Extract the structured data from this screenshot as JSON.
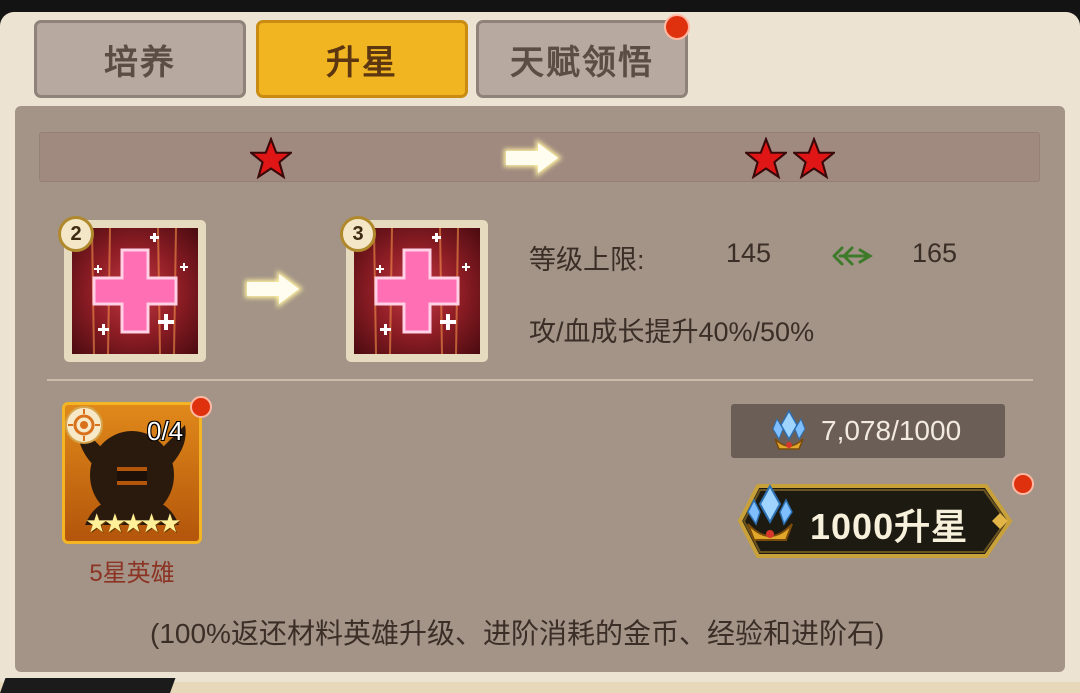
{
  "tabs": [
    {
      "label": "培养",
      "active": false
    },
    {
      "label": "升星",
      "active": true
    },
    {
      "label": "天赋领悟",
      "active": false,
      "notification": true
    }
  ],
  "star_transition": {
    "from_stars": 1,
    "to_stars": 2
  },
  "skill": {
    "from_level": "2",
    "to_level": "3",
    "level_cap_label": "等级上限:",
    "level_cap_from": "145",
    "level_cap_to": "165",
    "growth_text": "攻/血成长提升40%/50%"
  },
  "material": {
    "progress": "0/4",
    "stars": 5,
    "label": "5星英雄",
    "notification": true
  },
  "cost": {
    "text": "7,078/1000",
    "icon": "crystal-crown-icon"
  },
  "upgrade_button": {
    "label": "1000升星",
    "notification": true
  },
  "note": "(100%返还材料英雄升级、进阶消耗的金币、经验和进阶石)",
  "colors": {
    "active_tab": "#f0b521",
    "inactive_tab": "#b7a9a0",
    "panel": "#a39487",
    "notification_dot": "#e0310e",
    "star_red": "#e01515"
  }
}
